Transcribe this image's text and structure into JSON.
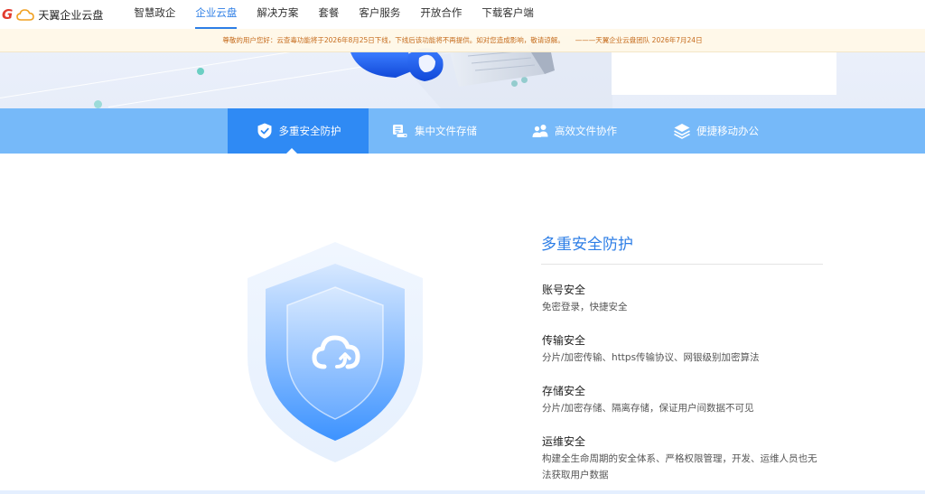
{
  "nav": {
    "logo_g": "G",
    "logo_text": "天翼企业云盘",
    "items": [
      {
        "label": "智慧政企",
        "active": false
      },
      {
        "label": "企业云盘",
        "active": true
      },
      {
        "label": "解决方案",
        "active": false
      },
      {
        "label": "套餐",
        "active": false
      },
      {
        "label": "客户服务",
        "active": false
      },
      {
        "label": "开放合作",
        "active": false
      },
      {
        "label": "下载客户端",
        "active": false
      }
    ]
  },
  "notice": {
    "text": "尊敬的用户您好：云查毒功能将于2026年8月25日下线，下线后该功能将不再提供。如对您造成影响，敬请谅解。",
    "signature": "———天翼企业云盘团队 2026年7月24日"
  },
  "tabs": [
    {
      "label": "多重安全防护",
      "icon": "shield-check-icon",
      "active": true
    },
    {
      "label": "集中文件存储",
      "icon": "file-storage-icon",
      "active": false
    },
    {
      "label": "高效文件协作",
      "icon": "users-icon",
      "active": false
    },
    {
      "label": "便捷移动办公",
      "icon": "layers-icon",
      "active": false
    }
  ],
  "section": {
    "title": "多重安全防护",
    "features": [
      {
        "title": "账号安全",
        "desc": "免密登录，快捷安全"
      },
      {
        "title": "传输安全",
        "desc": "分片/加密传输、https传输协议、网银级别加密算法"
      },
      {
        "title": "存储安全",
        "desc": "分片/加密存储、隔离存储，保证用户间数据不可见"
      },
      {
        "title": "运维安全",
        "desc": "构建全生命周期的安全体系、严格权限管理，开发、运维人员也无法获取用户数据"
      }
    ]
  },
  "colors": {
    "accent": "#2d7ee6",
    "tab_bar": "#76b9f9",
    "tab_active": "#2f8af4",
    "notice_text": "#c56a1b",
    "logo_red": "#e23b2e"
  }
}
